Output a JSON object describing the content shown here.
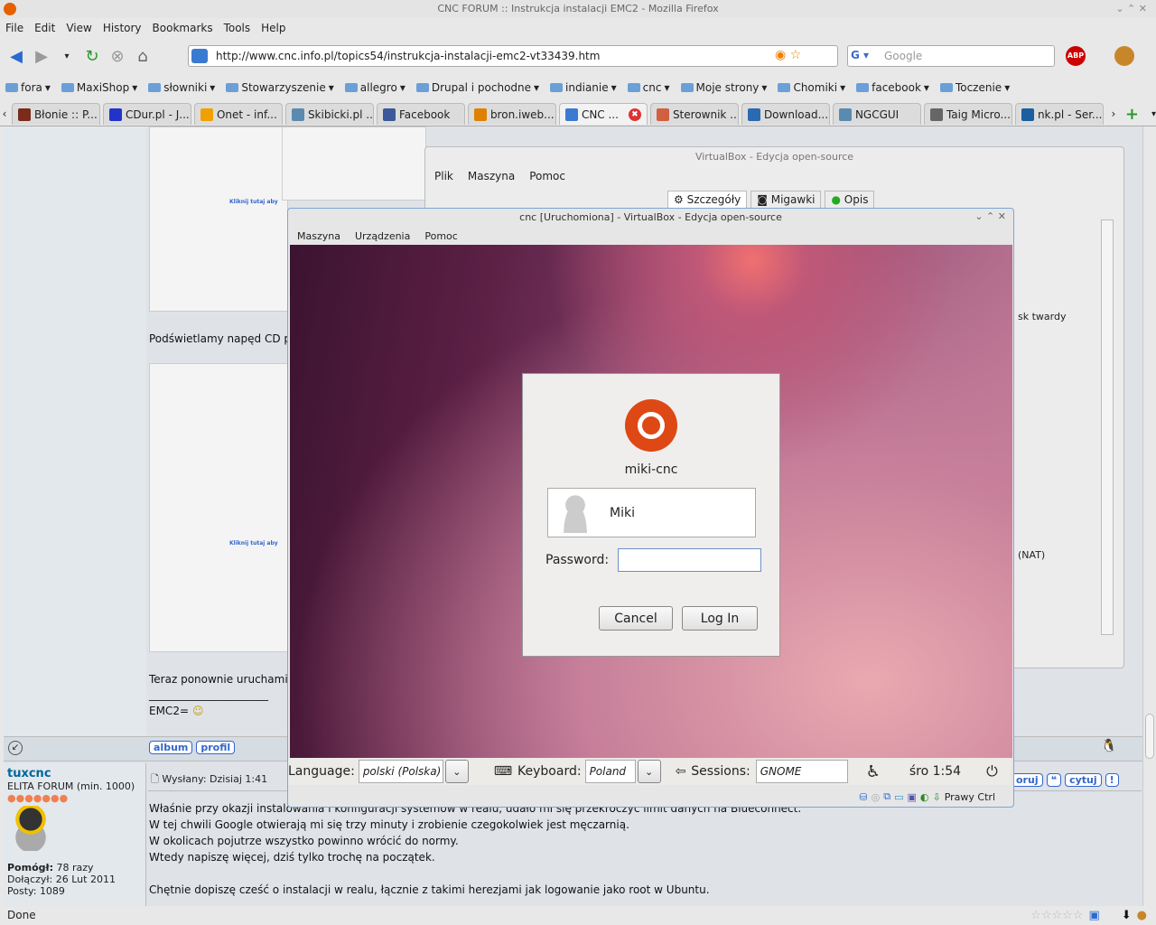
{
  "window": {
    "title": "CNC FORUM :: Instrukcja instalacji EMC2 - Mozilla Firefox"
  },
  "menu": [
    "File",
    "Edit",
    "View",
    "History",
    "Bookmarks",
    "Tools",
    "Help"
  ],
  "nav": {
    "url": "http://www.cnc.info.pl/topics54/instrukcja-instalacji-emc2-vt33439.htm",
    "search_placeholder": "Google"
  },
  "bookmarks": [
    "fora",
    "MaxiShop",
    "słowniki",
    "Stowarzyszenie",
    "allegro",
    "Drupal i pochodne",
    "indianie",
    "cnc",
    "Moje strony",
    "Chomiki",
    "facebook",
    "Toczenie"
  ],
  "tabs": [
    {
      "label": "Błonie :: P...",
      "color": "#7a2b1a"
    },
    {
      "label": "CDur.pl - J...",
      "color": "#2233cc"
    },
    {
      "label": "Onet - inf...",
      "color": "#f0a000"
    },
    {
      "label": "Skibicki.pl ...",
      "color": "#5a8ab0"
    },
    {
      "label": "Facebook",
      "color": "#3b5998"
    },
    {
      "label": "bron.iweb....",
      "color": "#e08000"
    },
    {
      "label": "CNC ...",
      "color": "#3a7ad0",
      "active": true
    },
    {
      "label": "Sterownik ...",
      "color": "#d06040"
    },
    {
      "label": "Download...",
      "color": "#2a6ab0"
    },
    {
      "label": "NGCGUI",
      "color": "#5a8ab0"
    },
    {
      "label": "Taig Micro...",
      "color": "#666"
    },
    {
      "label": "nk.pl - Ser...",
      "color": "#1a5fa0"
    }
  ],
  "forum": {
    "caption1": "Podświetlamy napęd CD p",
    "caption2": "Teraz ponownie uruchami",
    "signature_line": "______________________",
    "emc2": "EMC2=",
    "click_here": "Kliknij tutaj aby",
    "post_buttons_left": [
      "album",
      "profil"
    ],
    "post_buttons_right": [
      "oruj",
      "cytuj",
      "!"
    ],
    "bg_text_disk": "sk twardy",
    "bg_text_nat": "(NAT)",
    "post": {
      "author": "tuxcnc",
      "rank": "ELITA FORUM (min. 1000)",
      "helped_label": "Pomógł:",
      "helped": "78 razy",
      "joined_label": "Dołączył:",
      "joined": "26 Lut 2011",
      "posts_label": "Posty:",
      "posts": "1089",
      "sent": "Wysłany: Dzisiaj 1:41",
      "lines": [
        "Właśnie przy okazji instalowania i konfiguracji systemów w realu, udało mi się przekroczyć limit danych na Blueconnect.",
        "W tej chwili Google otwierają mi się trzy minuty i zrobienie czegokolwiek jest męczarnią.",
        "W okolicach pojutrze wszystko powinno wrócić do normy.",
        "Wtedy napiszę więcej, dziś tylko trochę na początek.",
        "",
        "Chętnie dopiszę cześć o instalacji w realu, łącznie z takimi herezjami jak logowanie jako root w Ubuntu."
      ]
    }
  },
  "vbox_manager": {
    "title": "VirtualBox - Edycja open-source",
    "menu": [
      "Plik",
      "Maszyna",
      "Pomoc"
    ],
    "tabs": [
      "Szczegóły",
      "Migawki",
      "Opis"
    ]
  },
  "vm": {
    "title": "cnc [Uruchomiona] - VirtualBox - Edycja open-source",
    "menu": [
      "Maszyna",
      "Urządzenia",
      "Pomoc"
    ],
    "host_key": "Prawy Ctrl",
    "login": {
      "hostname": "miki-cnc",
      "user": "Miki",
      "password_label": "Password:",
      "cancel": "Cancel",
      "login": "Log In"
    },
    "bar": {
      "language_label": "Language:",
      "language": "polski (Polska)",
      "keyboard_label": "Keyboard:",
      "keyboard": "Poland",
      "sessions_label": "Sessions:",
      "session": "GNOME",
      "clock": "śro  1:54"
    },
    "accent": "#dd4814"
  },
  "status": {
    "text": "Done"
  }
}
